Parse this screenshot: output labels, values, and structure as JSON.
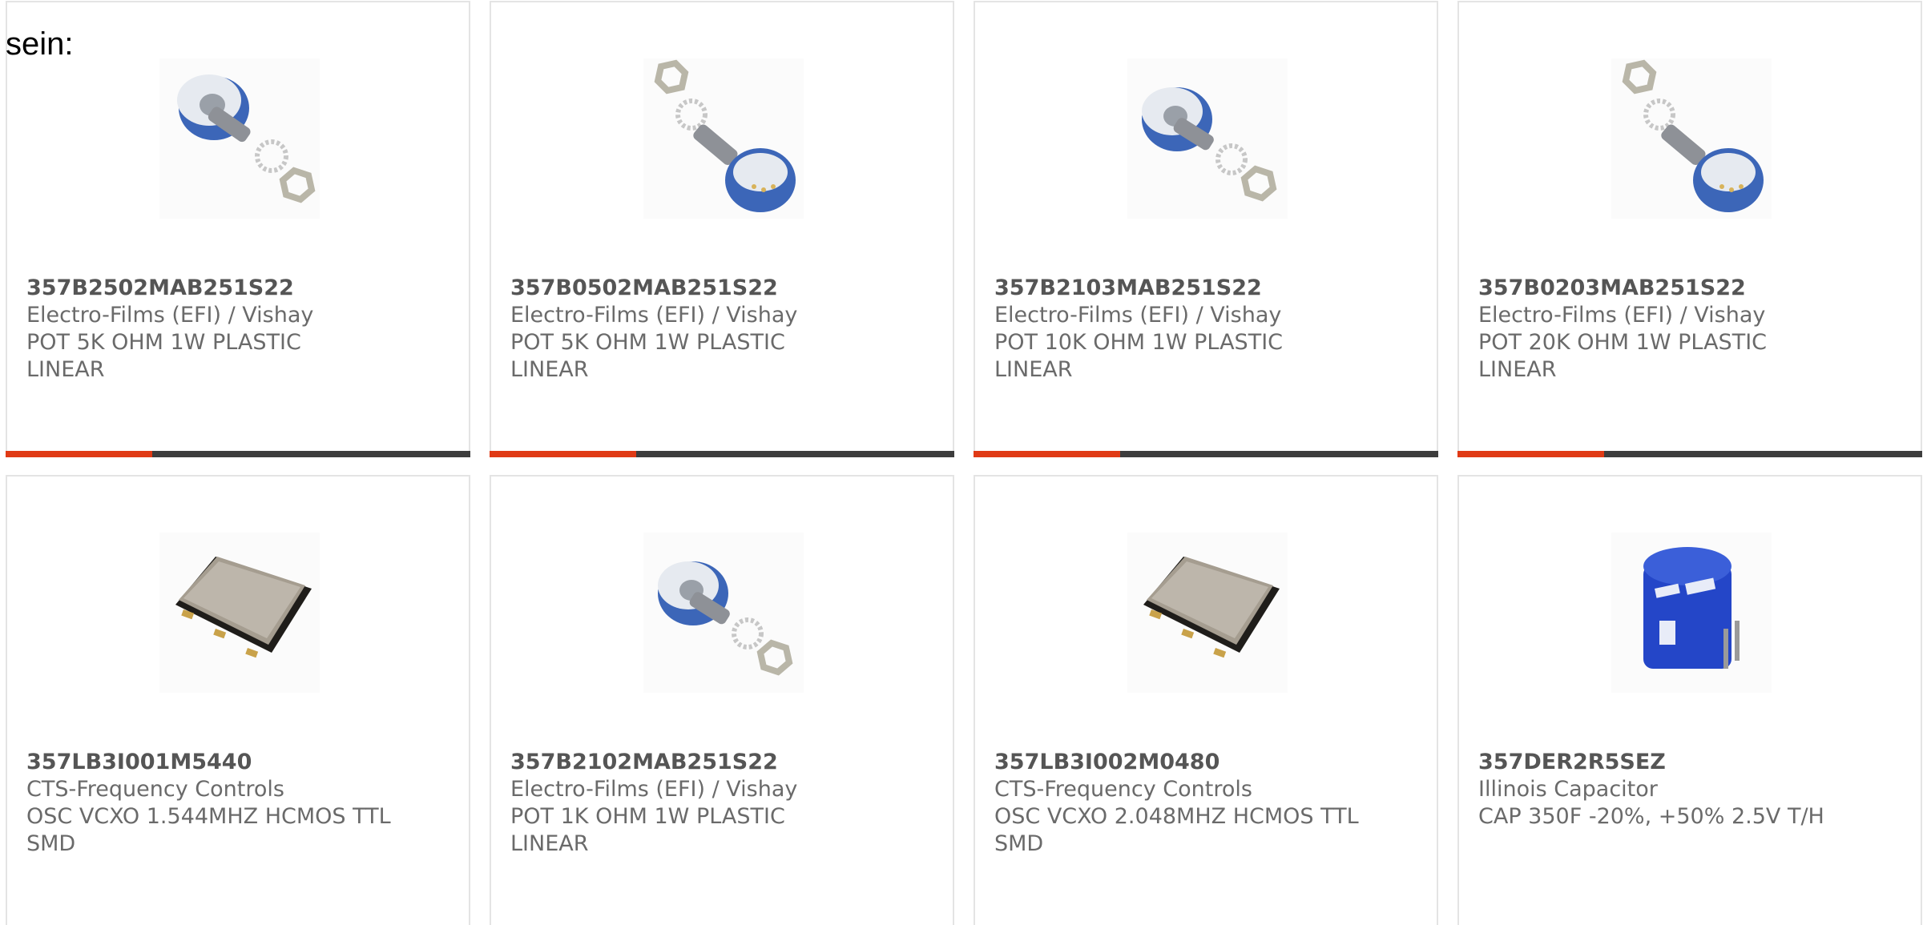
{
  "intro_text": "sein:",
  "products": [
    {
      "part_number": "357B2502MAB251S22",
      "manufacturer": "Electro-Films (EFI) / Vishay",
      "description_line1": "POT 5K OHM 1W PLASTIC",
      "description_line2": "LINEAR",
      "image_icon": "potentiometer-icon"
    },
    {
      "part_number": "357B0502MAB251S22",
      "manufacturer": "Electro-Films (EFI) / Vishay",
      "description_line1": "POT 5K OHM 1W PLASTIC",
      "description_line2": "LINEAR",
      "image_icon": "potentiometer-icon"
    },
    {
      "part_number": "357B2103MAB251S22",
      "manufacturer": "Electro-Films (EFI) / Vishay",
      "description_line1": "POT 10K OHM 1W PLASTIC",
      "description_line2": "LINEAR",
      "image_icon": "potentiometer-icon"
    },
    {
      "part_number": "357B0203MAB251S22",
      "manufacturer": "Electro-Films (EFI) / Vishay",
      "description_line1": "POT 20K OHM 1W PLASTIC",
      "description_line2": "LINEAR",
      "image_icon": "potentiometer-icon"
    },
    {
      "part_number": "357LB3I001M5440",
      "manufacturer": "CTS-Frequency Controls",
      "description_line1": "OSC VCXO 1.544MHZ HCMOS TTL",
      "description_line2": "SMD",
      "image_icon": "oscillator-chip-icon"
    },
    {
      "part_number": "357B2102MAB251S22",
      "manufacturer": "Electro-Films (EFI) / Vishay",
      "description_line1": "POT 1K OHM 1W PLASTIC",
      "description_line2": "LINEAR",
      "image_icon": "potentiometer-icon"
    },
    {
      "part_number": "357LB3I002M0480",
      "manufacturer": "CTS-Frequency Controls",
      "description_line1": "OSC VCXO 2.048MHZ HCMOS TTL",
      "description_line2": "SMD",
      "image_icon": "oscillator-chip-icon"
    },
    {
      "part_number": "357DER2R5SEZ",
      "manufacturer": "Illinois Capacitor",
      "description_line1": "CAP 350F -20%, +50% 2.5V T/H",
      "description_line2": "",
      "image_icon": "capacitor-icon"
    }
  ],
  "colors": {
    "accent": "#e03a15",
    "bar": "#3d3d3d",
    "border": "#e4e4e4",
    "text": "#6a6a6a"
  }
}
